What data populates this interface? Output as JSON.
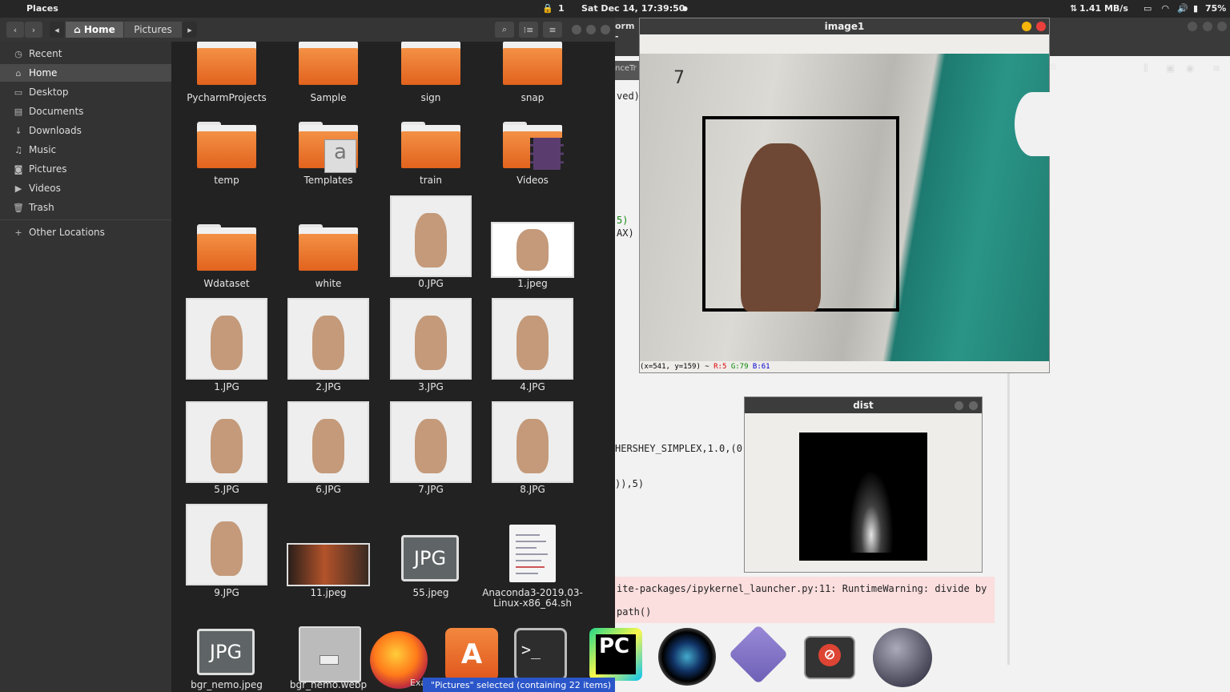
{
  "topbar": {
    "app_name": "Places",
    "indicator_number": "1",
    "datetime": "Sat Dec 14, 17:39:50",
    "network_speed": "1.41 MB/s",
    "battery": "75%"
  },
  "toolbar": {
    "crumbs": [
      "Home",
      "Pictures"
    ]
  },
  "sidebar": {
    "items": [
      {
        "label": "Recent",
        "icon": "clock-icon"
      },
      {
        "label": "Home",
        "icon": "home-icon"
      },
      {
        "label": "Desktop",
        "icon": "desktop-icon"
      },
      {
        "label": "Documents",
        "icon": "folder-icon"
      },
      {
        "label": "Downloads",
        "icon": "download-icon"
      },
      {
        "label": "Music",
        "icon": "music-icon"
      },
      {
        "label": "Pictures",
        "icon": "camera-icon"
      },
      {
        "label": "Videos",
        "icon": "video-icon"
      },
      {
        "label": "Trash",
        "icon": "trash-icon"
      },
      {
        "label": "Other Locations",
        "icon": "plus-icon"
      }
    ]
  },
  "files": [
    {
      "name": "PycharmProjects",
      "kind": "folder"
    },
    {
      "name": "Sample",
      "kind": "folder"
    },
    {
      "name": "sign",
      "kind": "folder"
    },
    {
      "name": "snap",
      "kind": "folder"
    },
    {
      "name": "temp",
      "kind": "folder"
    },
    {
      "name": "Templates",
      "kind": "folder"
    },
    {
      "name": "train",
      "kind": "folder"
    },
    {
      "name": "Videos",
      "kind": "folder"
    },
    {
      "name": "Wdataset",
      "kind": "folder"
    },
    {
      "name": "white",
      "kind": "folder"
    },
    {
      "name": "0.JPG",
      "kind": "image"
    },
    {
      "name": "1.jpeg",
      "kind": "image"
    },
    {
      "name": "1.JPG",
      "kind": "image"
    },
    {
      "name": "2.JPG",
      "kind": "image"
    },
    {
      "name": "3.JPG",
      "kind": "image"
    },
    {
      "name": "4.JPG",
      "kind": "image"
    },
    {
      "name": "5.JPG",
      "kind": "image"
    },
    {
      "name": "6.JPG",
      "kind": "image"
    },
    {
      "name": "7.JPG",
      "kind": "image"
    },
    {
      "name": "8.JPG",
      "kind": "image"
    },
    {
      "name": "9.JPG",
      "kind": "image"
    },
    {
      "name": "11.jpeg",
      "kind": "image"
    },
    {
      "name": "55.jpeg",
      "kind": "jpg-icon"
    },
    {
      "name": "Anaconda3-2019.03-Linux-x86_64.sh",
      "kind": "script"
    },
    {
      "name": "bgr_nemo.jpeg",
      "kind": "jpg-icon"
    },
    {
      "name": "bgr_nemo.webp",
      "kind": "image"
    }
  ],
  "image1_window": {
    "title": "image1",
    "overlay_text": "7",
    "status_coords": "(x=541, y=159) ~",
    "status_r": "R:5",
    "status_g": "G:79",
    "status_b": "B:61"
  },
  "dist_window": {
    "title": "dist"
  },
  "background_app": {
    "tab_fragment": "orm -",
    "tab2_fragment": "nceTr",
    "saved_fragment": "ved)",
    "code_lines": [
      "5)",
      "AX)",
      "HERSHEY_SIMPLEX,1.0,(0,",
      ")),5)"
    ],
    "warning_line1": "ite-packages/ipykernel_launcher.py:11: RuntimeWarning: divide by",
    "warning_line2": "path()"
  },
  "notification": {
    "text": "\"Pictures\" selected (containing 22 items)",
    "dock_label": "Exa"
  },
  "colors": {
    "folder_orange": "#e8702a",
    "selection_blue": "#2b56c9",
    "warning_pink": "#fbdede"
  }
}
